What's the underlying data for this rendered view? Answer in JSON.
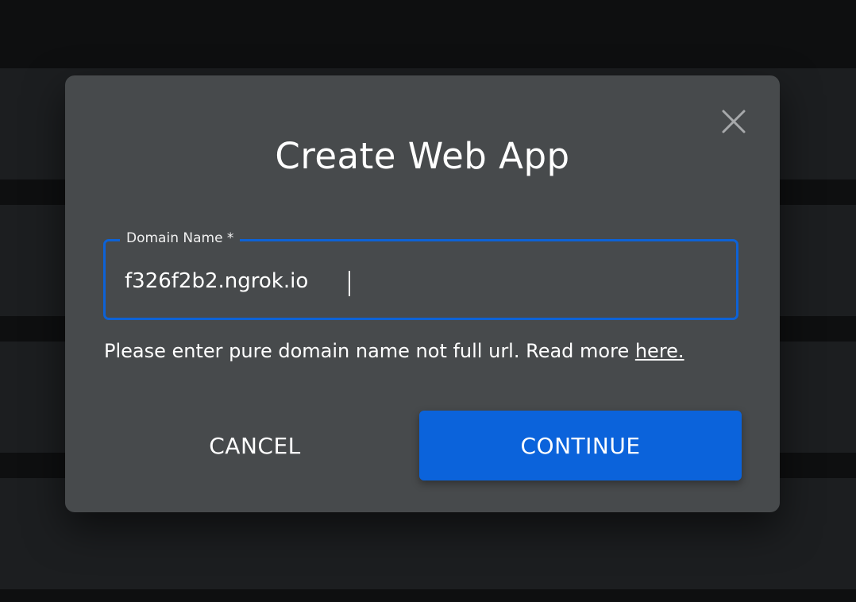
{
  "dialog": {
    "title": "Create Web App",
    "close_icon": "close-icon",
    "field": {
      "label": "Domain Name *",
      "value": "f326f2b2.ngrok.io",
      "placeholder": ""
    },
    "helper_text": "Please enter pure domain name not full url. Read more ",
    "helper_link": "here.",
    "cancel_label": "CANCEL",
    "continue_label": "CONTINUE"
  },
  "colors": {
    "accent": "#0b63db",
    "dialog_bg": "#474a4c",
    "page_bg": "#0e0f10"
  }
}
